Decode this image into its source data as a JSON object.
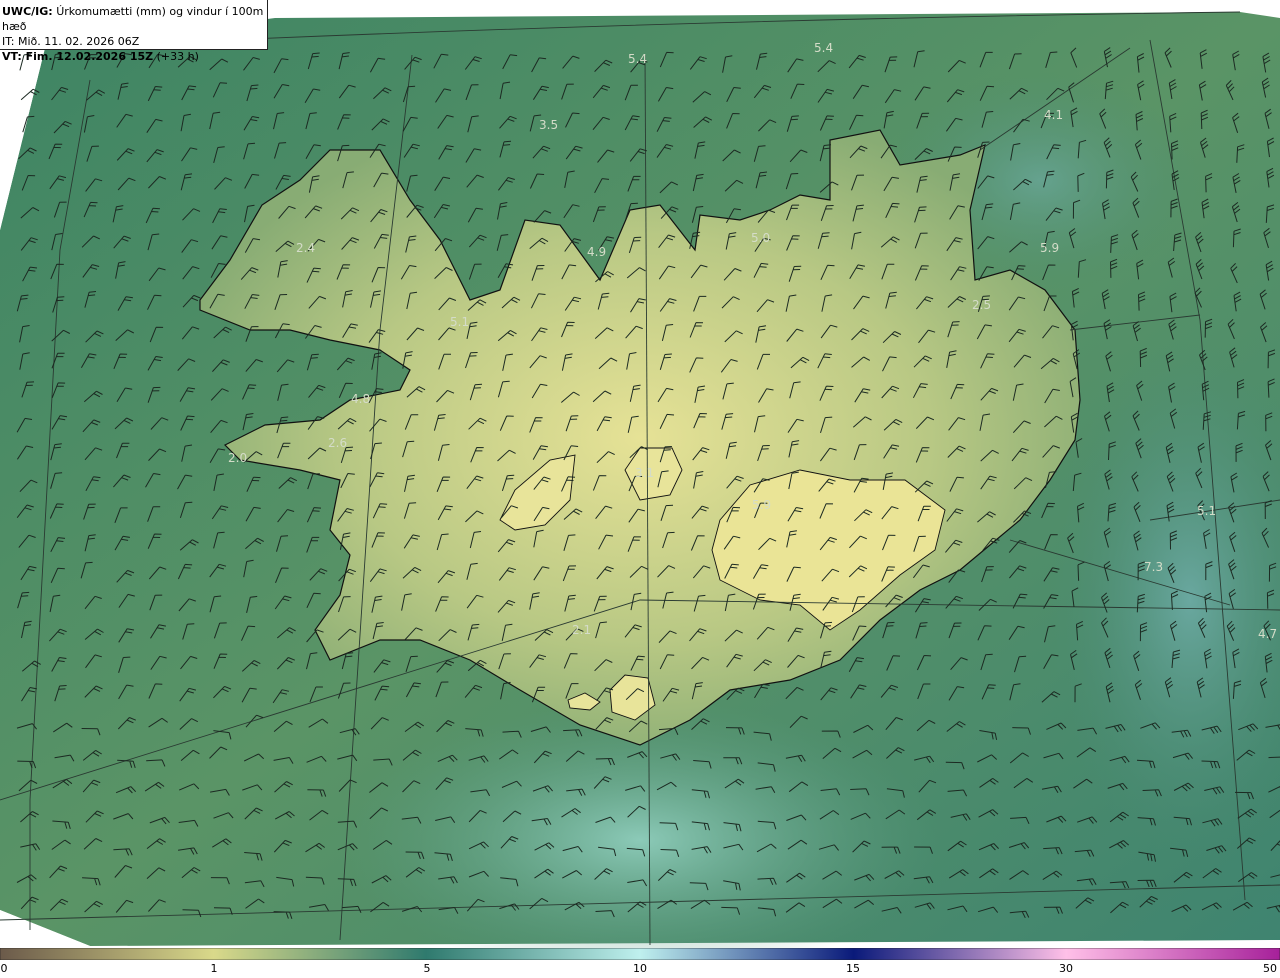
{
  "header": {
    "title_bold": "UWC/IG:",
    "title_rest": "Úrkomumætti (mm) og vindur í 100m hæð",
    "init_time": "IT: Mið. 11. 02. 2026 06Z",
    "valid_bold": "VT: Fim. 12.02.2026 15Z",
    "valid_rest": "(+33 h)"
  },
  "colorbar": {
    "ticks": [
      "0",
      "1",
      "5",
      "10",
      "15",
      "30",
      "50"
    ],
    "colors": [
      "#6b5a4a",
      "#d9d98a",
      "#2f7a6e",
      "#bff0ee",
      "#0a1a7a",
      "#ffc0e8",
      "#a6209a"
    ]
  },
  "map_labels": [
    "5.4",
    "5.4",
    "3.5",
    "4.1",
    "2.4",
    "4.9",
    "5.0",
    "5.9",
    "5.1",
    "2.5",
    "4.8",
    "2.6",
    "2.0",
    "3.1",
    "5.9",
    "5.1",
    "7.3",
    "4.7",
    "2.1"
  ],
  "colors": {
    "sea_deep": "#2e6e58",
    "sea_mid": "#4a8a68",
    "coast_green": "#7aa070",
    "land_light": "#d8dc8c",
    "sea_cyan": "#6cb0a4",
    "coastline": "#111111"
  }
}
